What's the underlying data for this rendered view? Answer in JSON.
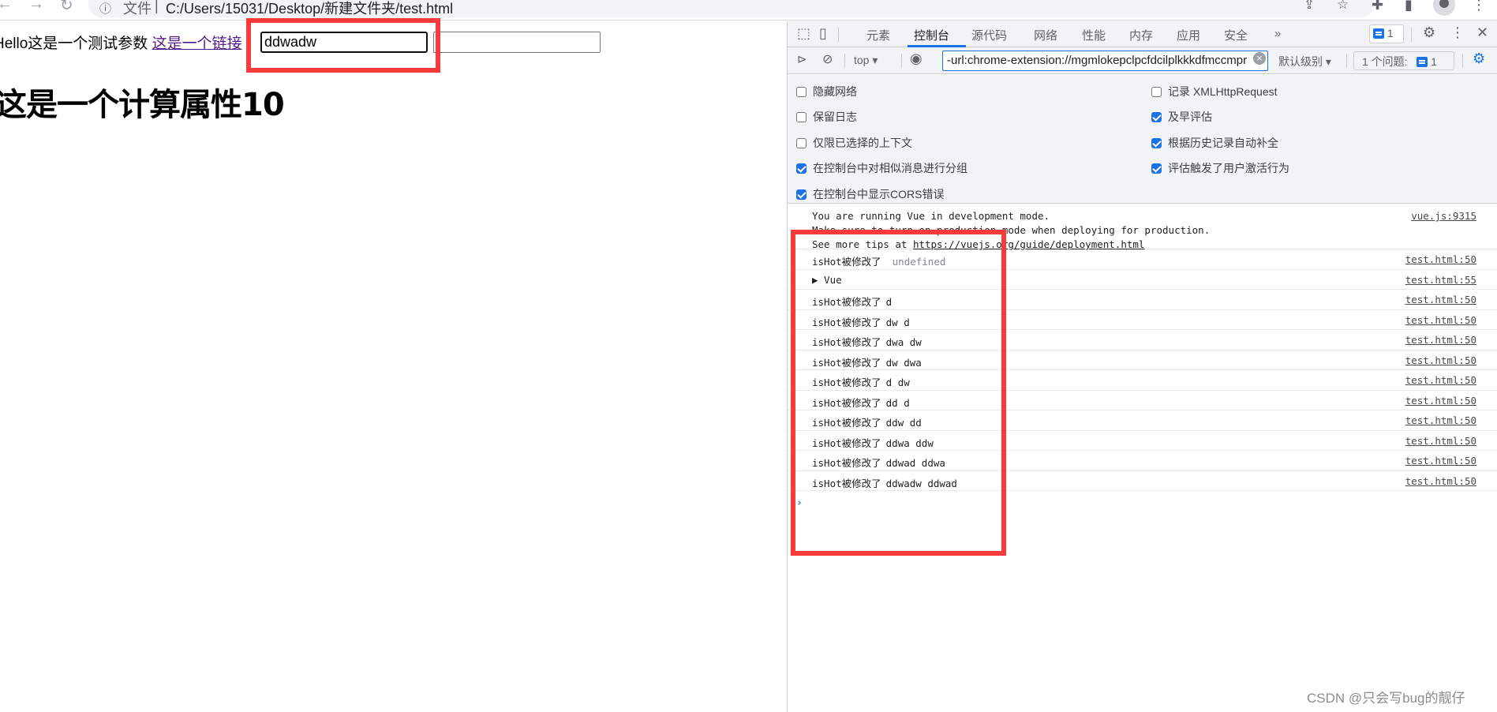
{
  "browser": {
    "nav": {
      "back_icon": "back-arrow-icon",
      "forward_icon": "forward-arrow-icon",
      "reload_icon": "reload-icon"
    },
    "address_bar": {
      "info_icon": "info-icon",
      "scheme_label": "文件",
      "url": "C:/Users/15031/Desktop/新建文件夹/test.html"
    },
    "toolbar_icons": [
      "share-icon",
      "star-icon",
      "extensions-icon",
      "sidepanel-icon",
      "profile-icon",
      "menu-icon"
    ]
  },
  "page": {
    "hello_text": "Hello这是一个测试参数",
    "link_text": "这是一个链接",
    "input_a_value": "ddwadw",
    "input_b_value": "",
    "heading": "这是一个计算属性10"
  },
  "devtools": {
    "tabs": [
      {
        "label": "元素",
        "active": false
      },
      {
        "label": "控制台",
        "active": true
      },
      {
        "label": "源代码",
        "active": false
      },
      {
        "label": "网络",
        "active": false
      },
      {
        "label": "性能",
        "active": false
      },
      {
        "label": "内存",
        "active": false
      },
      {
        "label": "应用",
        "active": false
      },
      {
        "label": "安全",
        "active": false
      }
    ],
    "more_tabs": "»",
    "issue_count": "1",
    "toolbar": {
      "context": "top",
      "filter_value": "-url:chrome-extension://mgmlokepclpcfdcilplkkkdfmccmpr",
      "level": "默认级别",
      "issues_label": "1 个问题:",
      "issues_count": "1"
    },
    "settings": {
      "left": [
        {
          "label": "隐藏网络",
          "checked": false
        },
        {
          "label": "保留日志",
          "checked": false
        },
        {
          "label": "仅限已选择的上下文",
          "checked": false
        },
        {
          "label": "在控制台中对相似消息进行分组",
          "checked": true
        },
        {
          "label": "在控制台中显示CORS错误",
          "checked": true
        }
      ],
      "right": [
        {
          "label": "记录 XMLHttpRequest",
          "checked": false
        },
        {
          "label": "及早评估",
          "checked": true
        },
        {
          "label": "根据历史记录自动补全",
          "checked": true
        },
        {
          "label": "评估触发了用户激活行为",
          "checked": true
        }
      ]
    },
    "console": {
      "vue_warning": {
        "line1": "You are running Vue in development mode.",
        "line2": "Make sure to turn on production mode when deploying for production.",
        "line3_prefix": "See more tips at ",
        "line3_link": "https://vuejs.org/guide/deployment.html",
        "source": "vue.js:9315"
      },
      "logs": [
        {
          "prefix": "isHot被修改了",
          "args": "undefined",
          "dim": true,
          "source": "test.html:50"
        },
        {
          "prefix": "▶ Vue",
          "args": "",
          "dim": false,
          "source": "test.html:55"
        },
        {
          "prefix": "isHot被修改了",
          "args": "d",
          "dim": false,
          "source": "test.html:50"
        },
        {
          "prefix": "isHot被修改了",
          "args": "dw d",
          "dim": false,
          "source": "test.html:50"
        },
        {
          "prefix": "isHot被修改了",
          "args": "dwa dw",
          "dim": false,
          "source": "test.html:50"
        },
        {
          "prefix": "isHot被修改了",
          "args": "dw dwa",
          "dim": false,
          "source": "test.html:50"
        },
        {
          "prefix": "isHot被修改了",
          "args": "d dw",
          "dim": false,
          "source": "test.html:50"
        },
        {
          "prefix": "isHot被修改了",
          "args": "dd d",
          "dim": false,
          "source": "test.html:50"
        },
        {
          "prefix": "isHot被修改了",
          "args": "ddw dd",
          "dim": false,
          "source": "test.html:50"
        },
        {
          "prefix": "isHot被修改了",
          "args": "ddwa ddw",
          "dim": false,
          "source": "test.html:50"
        },
        {
          "prefix": "isHot被修改了",
          "args": "ddwad ddwa",
          "dim": false,
          "source": "test.html:50"
        },
        {
          "prefix": "isHot被修改了",
          "args": "ddwadw ddwad",
          "dim": false,
          "source": "test.html:50"
        }
      ],
      "prompt": "›"
    }
  },
  "annotation_color": "#f93a3b",
  "accent_color": "#1a73e8",
  "watermark": "CSDN @只会写bug的靓仔"
}
